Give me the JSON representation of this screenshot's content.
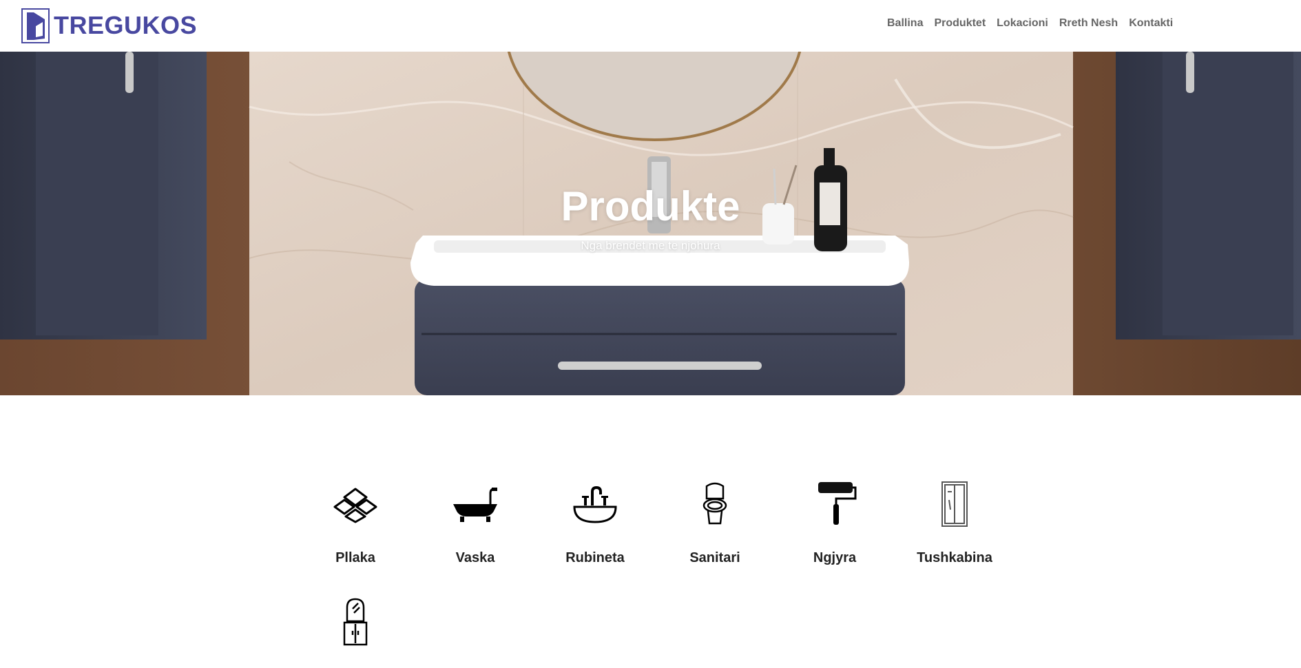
{
  "header": {
    "logo_text": "TREGUKOS",
    "brand_color": "#4848a0",
    "nav": [
      {
        "label": "Ballina"
      },
      {
        "label": "Produktet"
      },
      {
        "label": "Lokacioni"
      },
      {
        "label": "Rreth Nesh"
      },
      {
        "label": "Kontakti"
      }
    ]
  },
  "hero": {
    "title": "Produkte",
    "subtitle": "Nga brendet me te njohura"
  },
  "categories": [
    {
      "label": "Pllaka",
      "icon": "tiles-icon"
    },
    {
      "label": "Vaska",
      "icon": "bathtub-icon"
    },
    {
      "label": "Rubineta",
      "icon": "faucet-sink-icon"
    },
    {
      "label": "Sanitari",
      "icon": "toilet-icon"
    },
    {
      "label": "Ngjyra",
      "icon": "paint-roller-icon"
    },
    {
      "label": "Tushkabina",
      "icon": "shower-cabin-icon"
    },
    {
      "label": "",
      "icon": "mirror-cabinet-icon"
    }
  ]
}
